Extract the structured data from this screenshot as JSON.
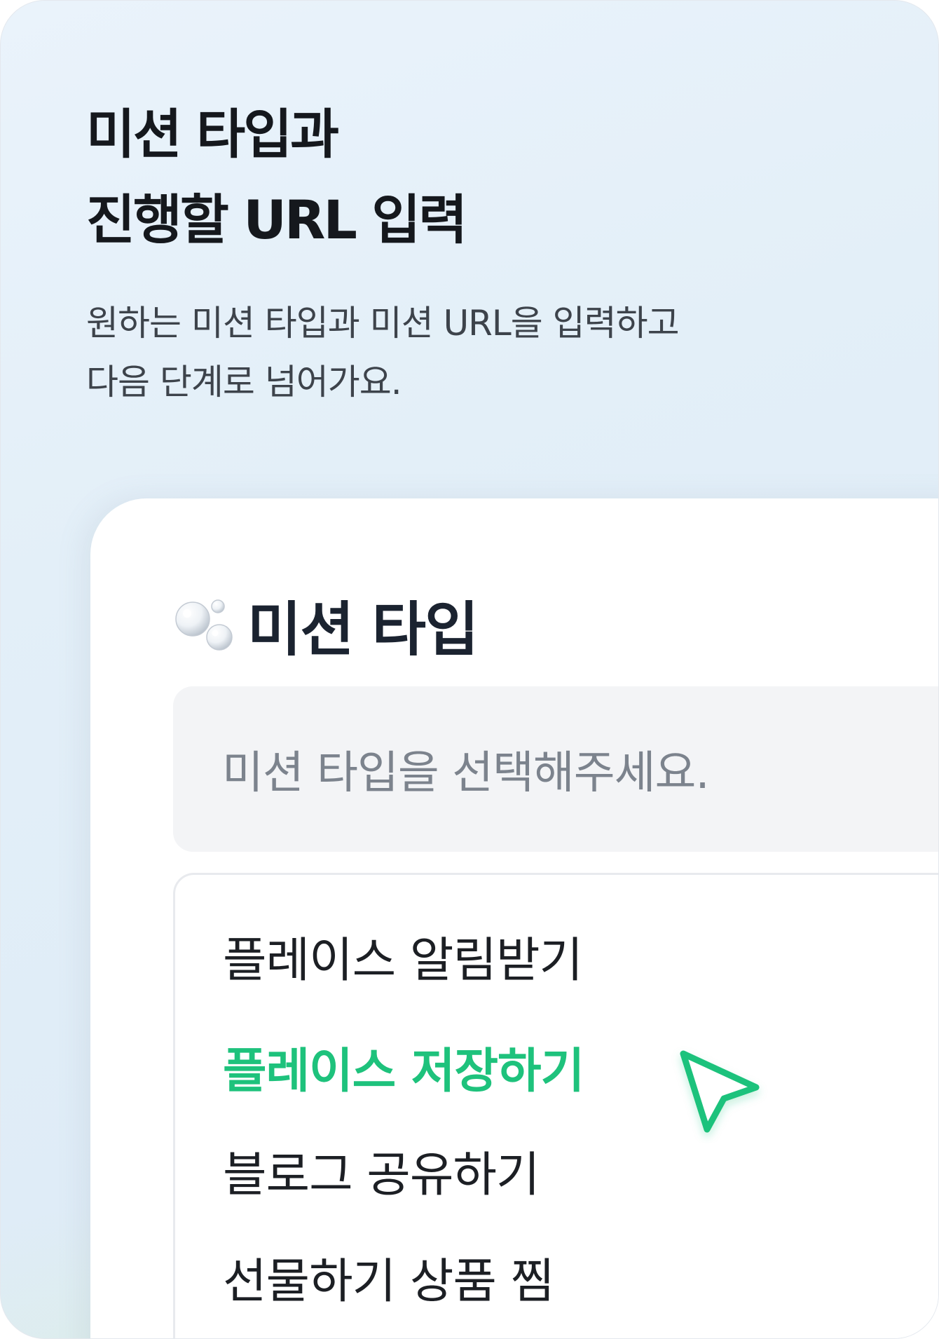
{
  "header": {
    "title_line1": "미션 타입과",
    "title_line2": "진행할 URL 입력",
    "description_line1": "원하는 미션 타입과 미션 URL을 입력하고",
    "description_line2": "다음 단계로 넘어가요."
  },
  "mission_type": {
    "icon": "bubbles-icon",
    "title": "미션 타입",
    "select_placeholder": "미션 타입을 선택해주세요.",
    "options": [
      {
        "label": "플레이스 알림받기",
        "selected": false
      },
      {
        "label": "플레이스 저장하기",
        "selected": true
      },
      {
        "label": "블로그 공유하기",
        "selected": false
      },
      {
        "label": "선물하기 상품 찜",
        "selected": false
      }
    ]
  },
  "pointer": {
    "icon": "cursor-icon"
  },
  "colors": {
    "accent_green": "#1ec27c",
    "title_text": "#15181d",
    "placeholder_text": "#7c838d",
    "select_background": "#f3f4f6"
  }
}
